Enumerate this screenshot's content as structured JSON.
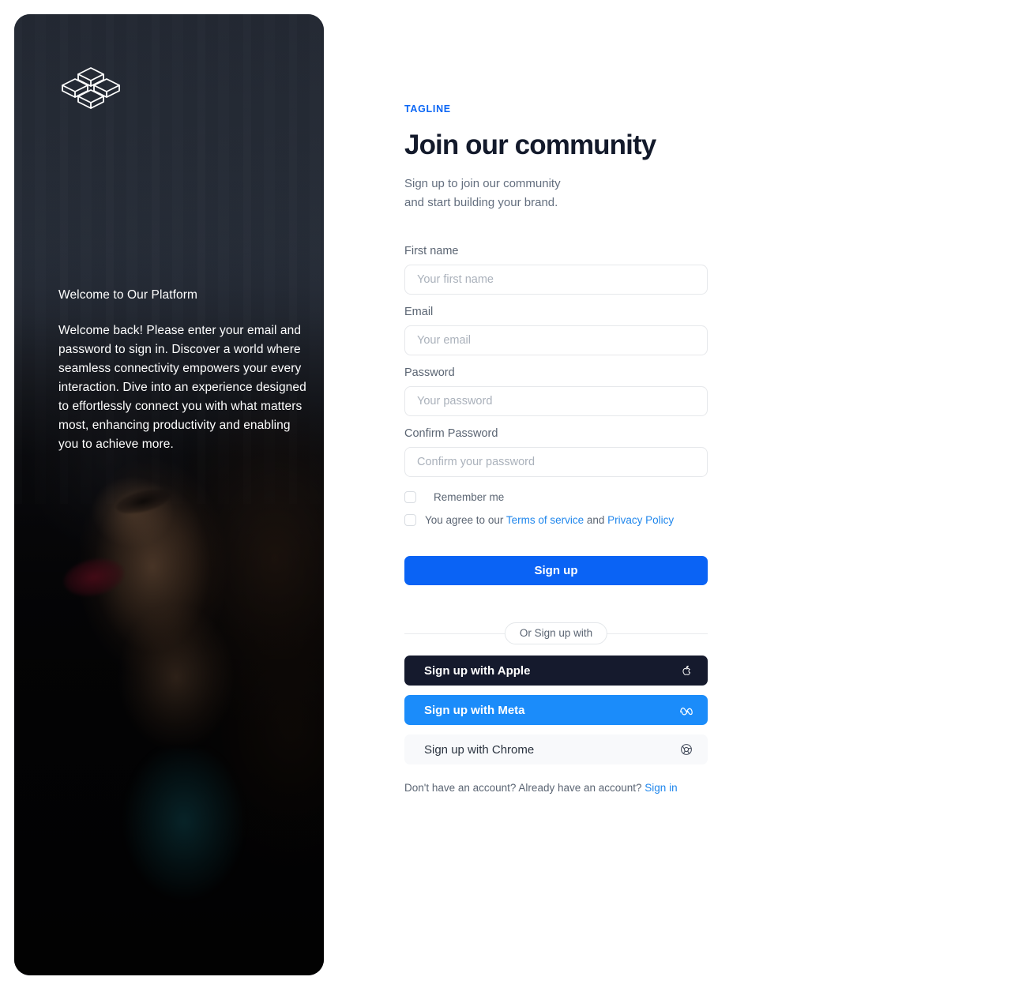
{
  "hero": {
    "logo_icon": "cubes-logo-icon",
    "title": "Welcome to Our Platform",
    "body": "Welcome back! Please enter your email and password to sign in. Discover a world where seamless connectivity empowers your every interaction. Dive into an experience designed to effortlessly connect you with what matters most, enhancing productivity and enabling you to achieve more."
  },
  "form": {
    "tagline": "TAGLINE",
    "headline": "Join our community",
    "subhead": "Sign up to join our community\nand start building your brand.",
    "fields": [
      {
        "label": "First name",
        "placeholder": "Your first name",
        "value": "",
        "type": "text"
      },
      {
        "label": "Email",
        "placeholder": "Your email",
        "value": "",
        "type": "text"
      },
      {
        "label": "Password",
        "placeholder": "Your password",
        "value": "",
        "type": "password"
      },
      {
        "label": "Confirm Password",
        "placeholder": "Confirm your password",
        "value": "",
        "type": "password"
      }
    ],
    "remember": {
      "label": "Remember me",
      "checked": false
    },
    "terms": {
      "prefix": "You agree to our ",
      "terms_link": "Terms of service",
      "middle": " and ",
      "privacy_link": "Privacy Policy",
      "checked": false
    },
    "submit_label": "Sign up",
    "divider_label": "Or Sign up with",
    "social": [
      {
        "label": "Sign up with Apple",
        "icon": "apple-icon"
      },
      {
        "label": "Sign up with Meta",
        "icon": "meta-icon"
      },
      {
        "label": "Sign up with Chrome",
        "icon": "chrome-icon"
      }
    ],
    "footer": {
      "text": "Don't have an account? Already have an account? ",
      "link": "Sign in"
    }
  },
  "colors": {
    "accent": "#0a63f5",
    "link": "#1f86ec",
    "apple": "#151a2d",
    "meta": "#1b8cfa",
    "chrome": "#f8f9fb",
    "heading": "#131a2b"
  }
}
